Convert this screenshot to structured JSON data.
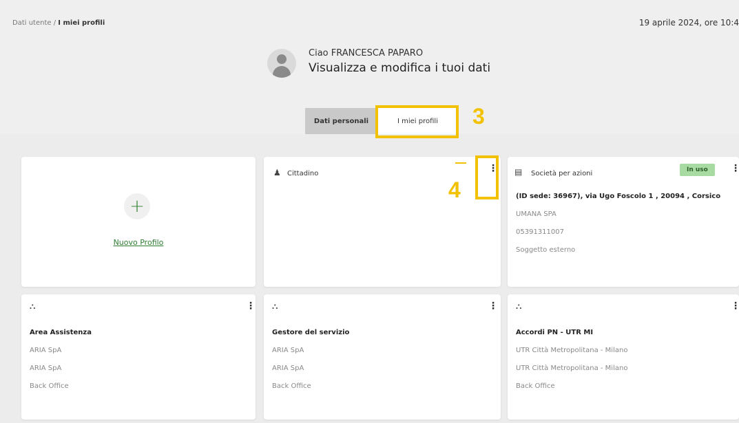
{
  "breadcrumb": {
    "parent": "Dati utente",
    "separator": "/",
    "current": "I miei profili"
  },
  "date": "19 aprile 2024, ore 10:4",
  "user": {
    "greeting": "Ciao FRANCESCA PAPARO",
    "subtitle": "Visualizza e modifica i tuoi dati"
  },
  "tabs": {
    "personal": "Dati personali",
    "profiles": "I miei profili"
  },
  "annotations": {
    "step3": "3",
    "step4": "4"
  },
  "cards": {
    "new_profile": {
      "label": "Nuovo Profilo",
      "icon": "plus-icon"
    },
    "cittadino": {
      "title": "Cittadino",
      "icon": "person-icon"
    },
    "spa": {
      "title": "Società per azioni",
      "badge": "In uso",
      "address": "(ID sede: 36967), via Ugo Foscolo 1 , 20094 , Corsico",
      "company": "UMANA SPA",
      "code": "05391311007",
      "type": "Soggetto esterno",
      "icon": "building-icon"
    },
    "area_assistenza": {
      "title": "Area Assistenza",
      "line1": "ARIA SpA",
      "line2": "ARIA SpA",
      "line3": "Back Office",
      "icon": "institution-icon"
    },
    "gestore": {
      "title": "Gestore del servizio",
      "line1": "ARIA SpA",
      "line2": "ARIA SpA",
      "line3": "Back Office",
      "icon": "institution-icon"
    },
    "accordi": {
      "title": "Accordi PN - UTR MI",
      "line1": "UTR Città Metropolitana - Milano",
      "line2": "UTR Città Metropolitana - Milano",
      "line3": "Back Office",
      "icon": "institution-icon"
    }
  },
  "colors": {
    "highlight": "#f2c200",
    "link": "#2e7d32",
    "badge_bg": "#a8dba2"
  }
}
